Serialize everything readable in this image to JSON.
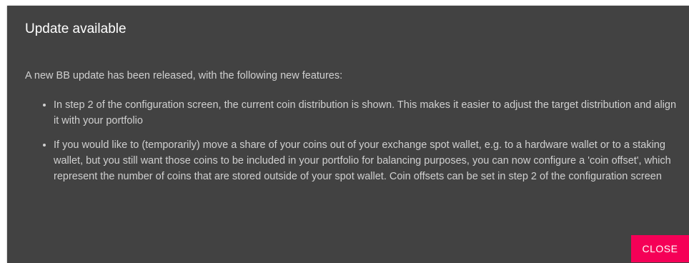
{
  "dialog": {
    "title": "Update available",
    "intro": "A new BB update has been released, with the following new features:",
    "features": [
      "In step 2 of the configuration screen, the current coin distribution is shown. This makes it easier to adjust the target distribution and align it with your portfolio",
      "If you would like to (temporarily) move a share of your coins out of your exchange spot wallet, e.g. to a hardware wallet or to a staking wallet, but you still want those coins to be included in your portfolio for balancing purposes, you can now configure a 'coin offset', which represent the number of coins that are stored outside of your spot wallet. Coin offsets can be set in step 2 of the configuration screen"
    ],
    "close_label": "Close",
    "accent_color": "#f50057",
    "background_color": "#424242"
  }
}
